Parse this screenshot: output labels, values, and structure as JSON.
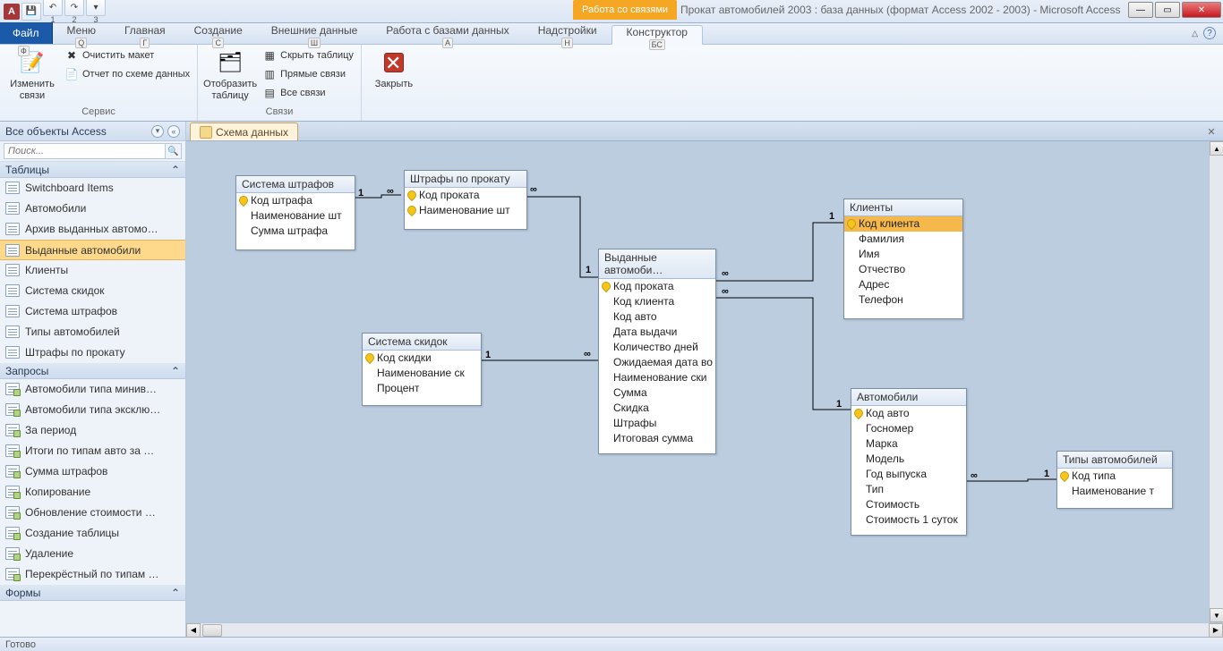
{
  "app": {
    "letter": "A",
    "context": "Работа со связями",
    "title": "Прокат автомобилей 2003 : база данных (формат Access 2002 - 2003)  -  Microsoft Access"
  },
  "qat": [
    "1",
    "2",
    "3"
  ],
  "tabs": {
    "file": "Файл",
    "items": [
      {
        "label": "Меню",
        "key": "Q"
      },
      {
        "label": "Главная",
        "key": "Г"
      },
      {
        "label": "Создание",
        "key": "С"
      },
      {
        "label": "Внешние данные",
        "key": "Ш"
      },
      {
        "label": "Работа с базами данных",
        "key": "А"
      },
      {
        "label": "Надстройки",
        "key": "Н"
      },
      {
        "label": "Конструктор",
        "key": "БС",
        "active": true
      }
    ],
    "file_key": "Ф"
  },
  "ribbon": {
    "g1": {
      "label": "Сервис",
      "edit": "Изменить связи",
      "clear": "Очистить макет",
      "report": "Отчет по схеме данных"
    },
    "g2": {
      "label": "Связи",
      "show": "Отобразить таблицу",
      "hide": "Скрыть таблицу",
      "direct": "Прямые связи",
      "all": "Все связи"
    },
    "g3": {
      "close": "Закрыть"
    }
  },
  "nav": {
    "header": "Все объекты Access",
    "search": "Поиск...",
    "sec1": "Таблицы",
    "tables": [
      "Switchboard Items",
      "Автомобили",
      "Архив выданных автомо…",
      "Выданные автомобили",
      "Клиенты",
      "Система скидок",
      "Система штрафов",
      "Типы автомобилей",
      "Штрафы по прокату"
    ],
    "sec2": "Запросы",
    "queries": [
      "Автомобили типа минив…",
      "Автомобили типа эксклю…",
      "За период",
      "Итоги по типам авто за …",
      "Сумма штрафов",
      "Копирование",
      "Обновление стоимости …",
      "Создание таблицы",
      "Удаление",
      "Перекрёстный по типам …"
    ],
    "sec3": "Формы"
  },
  "doc": {
    "tab": "Схема данных"
  },
  "tables": {
    "shtraf": {
      "title": "Система штрафов",
      "fields": [
        "Код штрафа",
        "Наименование шт",
        "Сумма штрафа"
      ]
    },
    "shtrafp": {
      "title": "Штрафы по прокату",
      "fields": [
        "Код проката",
        "Наименование шт"
      ]
    },
    "skidok": {
      "title": "Система скидок",
      "fields": [
        "Код скидки",
        "Наименование ск",
        "Процент"
      ]
    },
    "vydan": {
      "title": "Выданные автомоби…",
      "fields": [
        "Код проката",
        "Код клиента",
        "Код авто",
        "Дата выдачи",
        "Количество дней",
        "Ожидаемая дата во",
        "Наименование ски",
        "Сумма",
        "Скидка",
        "Штрафы",
        "Итоговая сумма"
      ]
    },
    "klienty": {
      "title": "Клиенты",
      "fields": [
        "Код клиента",
        "Фамилия",
        "Имя",
        "Отчество",
        "Адрес",
        "Телефон"
      ]
    },
    "avto": {
      "title": "Автомобили",
      "fields": [
        "Код авто",
        "Госномер",
        "Марка",
        "Модель",
        "Год выпуска",
        "Тип",
        "Стоимость",
        "Стоимость 1 суток"
      ]
    },
    "tipy": {
      "title": "Типы автомобилей",
      "fields": [
        "Код типа",
        "Наименование т"
      ]
    }
  },
  "status": "Готово"
}
